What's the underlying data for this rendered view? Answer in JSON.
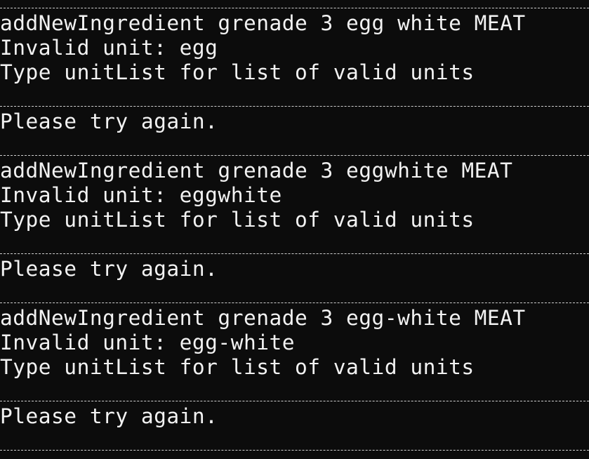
{
  "terminal": {
    "blocks": [
      {
        "command": "addNewIngredient grenade 3 egg white MEAT",
        "error": "Invalid unit: egg",
        "hint": "Type unitList for list of valid units",
        "retry": "Please try again."
      },
      {
        "command": "addNewIngredient grenade 3 eggwhite MEAT",
        "error": "Invalid unit: eggwhite",
        "hint": "Type unitList for list of valid units",
        "retry": "Please try again."
      },
      {
        "command": "addNewIngredient grenade 3 egg-white MEAT",
        "error": "Invalid unit: egg-white",
        "hint": "Type unitList for list of valid units",
        "retry": "Please try again."
      }
    ]
  },
  "colors": {
    "background": "#0c0c0c",
    "text": "#f2f2f2",
    "separator": "#cfcfcf"
  }
}
